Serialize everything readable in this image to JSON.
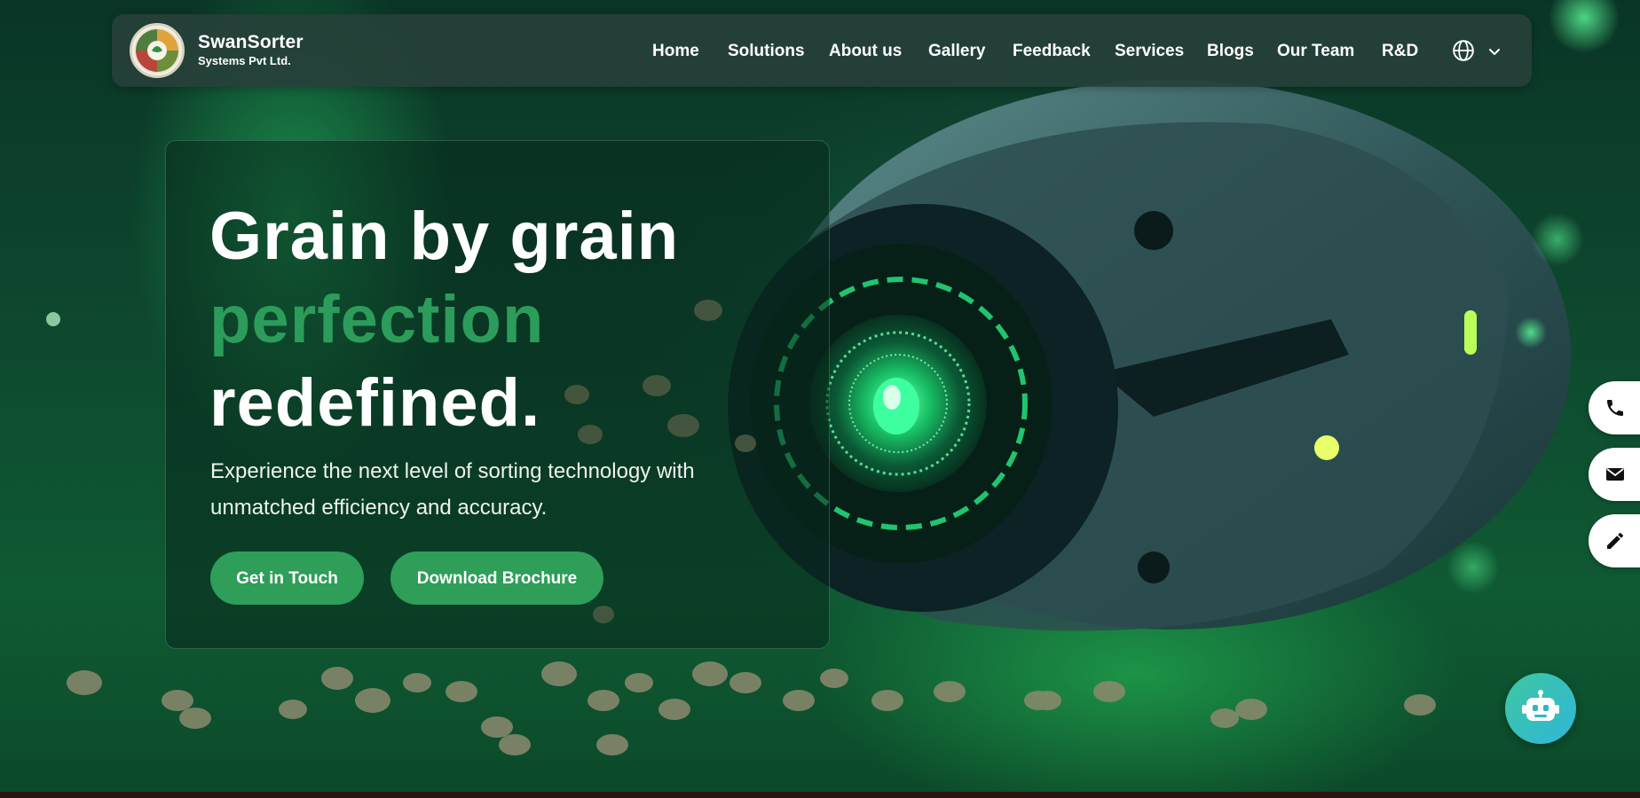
{
  "brand": {
    "name": "SwanSorter",
    "subtitle": "Systems Pvt Ltd."
  },
  "nav": {
    "items": [
      {
        "label": "Home"
      },
      {
        "label": "Solutions"
      },
      {
        "label": "About us"
      },
      {
        "label": "Gallery"
      },
      {
        "label": "Feedback"
      },
      {
        "label": "Services"
      },
      {
        "label": "Blogs"
      },
      {
        "label": "Our Team"
      },
      {
        "label": "R&D"
      }
    ],
    "language_icon": "globe-icon",
    "language_dropdown_icon": "chevron-down-icon"
  },
  "hero": {
    "headline_line1": "Grain by grain",
    "headline_line2": "perfection",
    "headline_line3": "redefined.",
    "description": "Experience the next level of sorting technology with unmatched efficiency and accuracy.",
    "primary_button": "Get in Touch",
    "secondary_button": "Download Brochure"
  },
  "side_actions": [
    {
      "icon": "phone-icon"
    },
    {
      "icon": "mail-icon"
    },
    {
      "icon": "pencil-icon"
    }
  ],
  "chatbot": {
    "icon": "robot-icon"
  },
  "colors": {
    "accent": "#2e9e59",
    "headline_accent": "#2c9c5a",
    "navbar": "#26403a",
    "chatbot_gradient": [
      "#3fc7a0",
      "#2fb6d9"
    ]
  }
}
